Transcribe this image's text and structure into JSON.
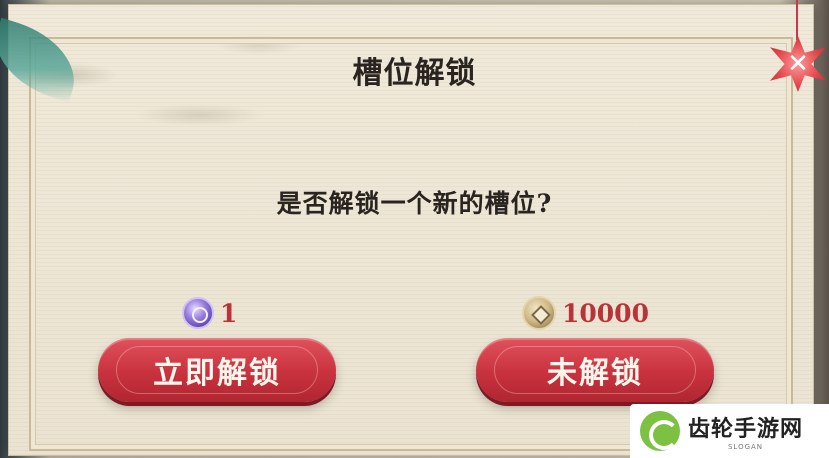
{
  "dialog": {
    "title": "槽位解锁",
    "question": "是否解锁一个新的槽位?"
  },
  "costs": {
    "unlock_now": {
      "icon": "gem-icon",
      "value": "1"
    },
    "not_unlock": {
      "icon": "coin-icon",
      "value": "10000"
    }
  },
  "buttons": {
    "unlock_now_label": "立即解锁",
    "not_unlock_label": "未解锁",
    "close_label": "✕"
  },
  "watermark": {
    "name": "齿轮手游网",
    "slogan": "SLOGAN"
  },
  "colors": {
    "button_red": "#c8323e",
    "cost_text": "#b8333a",
    "panel": "#ebe3d1"
  }
}
